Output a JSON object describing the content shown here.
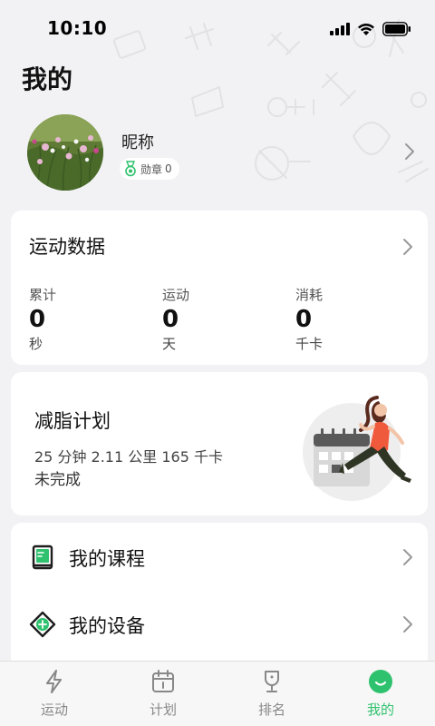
{
  "status_bar": {
    "time": "10:10"
  },
  "page": {
    "title": "我的"
  },
  "profile": {
    "nickname": "昵称",
    "badge_label": "勋章",
    "badge_count": "0"
  },
  "stats": {
    "title": "运动数据",
    "items": [
      {
        "label": "累计",
        "value": "0",
        "unit": "秒"
      },
      {
        "label": "运动",
        "value": "0",
        "unit": "天"
      },
      {
        "label": "消耗",
        "value": "0",
        "unit": "千卡"
      }
    ]
  },
  "plan": {
    "title": "减脂计划",
    "detail": "25 分钟 2.11 公里 165 千卡",
    "status": "未完成"
  },
  "menu": {
    "items": [
      {
        "label": "我的课程",
        "icon": "book-icon"
      },
      {
        "label": "我的设备",
        "icon": "device-icon"
      }
    ]
  },
  "tabbar": {
    "items": [
      {
        "label": "运动",
        "icon": "lightning-icon",
        "active": false
      },
      {
        "label": "计划",
        "icon": "calendar-icon",
        "active": false
      },
      {
        "label": "排名",
        "icon": "trophy-icon",
        "active": false
      },
      {
        "label": "我的",
        "icon": "smile-icon",
        "active": true
      }
    ]
  },
  "colors": {
    "accent": "#2fc26e",
    "background": "#f2f2f4",
    "card": "#ffffff",
    "plan_illustration_accent": "#f05a3c"
  }
}
